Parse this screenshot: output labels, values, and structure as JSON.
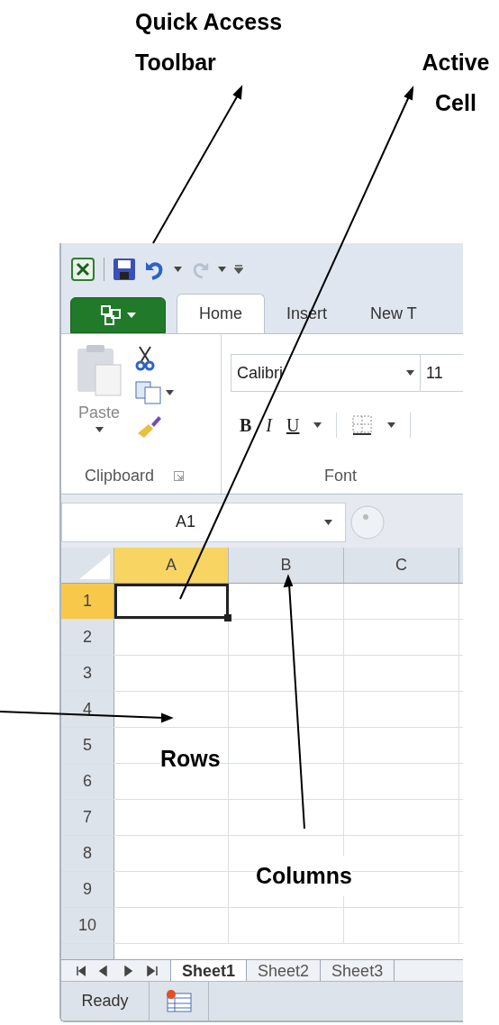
{
  "annotations": [
    {
      "kind": "toolbar",
      "text": "Quick Access Toolbar"
    },
    {
      "kind": "cell",
      "text": "Active Cell"
    },
    {
      "kind": "rows",
      "text": "Rows"
    },
    {
      "kind": "columns",
      "text": "Columns"
    }
  ],
  "tabs": [
    {
      "label": "Home",
      "selected": true
    },
    {
      "label": "Insert",
      "selected": false
    },
    {
      "label": "New T",
      "selected": false
    }
  ],
  "ribbon": {
    "paste_label": "Paste",
    "font_name": "Calibri",
    "font_size": "11",
    "format_buttons": [
      "B",
      "I",
      "U"
    ],
    "groups": [
      "Clipboard",
      "Font"
    ]
  },
  "name_box": "A1",
  "columns": [
    {
      "label": "A",
      "selected": true
    },
    {
      "label": "B",
      "selected": false
    },
    {
      "label": "C",
      "selected": false
    }
  ],
  "rows": [
    {
      "label": "1",
      "selected": true
    },
    {
      "label": "2",
      "selected": false
    },
    {
      "label": "3",
      "selected": false
    },
    {
      "label": "4",
      "selected": false
    },
    {
      "label": "5",
      "selected": false
    },
    {
      "label": "6",
      "selected": false
    },
    {
      "label": "7",
      "selected": false
    },
    {
      "label": "8",
      "selected": false
    },
    {
      "label": "9",
      "selected": false
    },
    {
      "label": "10",
      "selected": false
    }
  ],
  "sheet_tabs": [
    {
      "label": "Sheet1",
      "selected": true
    },
    {
      "label": "Sheet2",
      "selected": false
    },
    {
      "label": "Sheet3",
      "selected": false
    }
  ],
  "status": "Ready"
}
